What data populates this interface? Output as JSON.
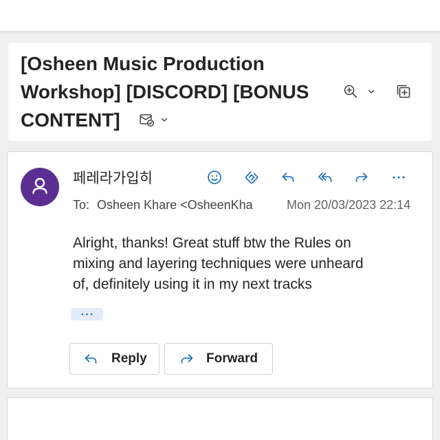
{
  "colors": {
    "accent": "#0f6cbd",
    "avatar_background": "#5c2e91",
    "text": "#242424",
    "secondary_text": "#616161"
  },
  "subject": {
    "text": "[Osheen Music Production Workshop] [DISCORD] [BONUS CONTENT]",
    "label_icon": "mail-shield-icon",
    "tools": [
      "zoom-in-icon",
      "square-plus-icon"
    ]
  },
  "message": {
    "avatar_icon": "person-icon",
    "sender": "페레라가입히",
    "actions": [
      "smiley-icon",
      "loop-icon",
      "reply-icon",
      "reply-all-icon",
      "forward-icon",
      "more-icon"
    ],
    "to_label": "To:",
    "recipient": "Osheen Khare <OsheenKha",
    "date": "Mon 20/03/2023 22:14",
    "body": "Alright, thanks! Great stuff btw the Rules on mixing and layering techniques were unheard of, definitely using it in my next tracks",
    "show_more_icon": "ellipsis-icon",
    "reply_button": {
      "icon": "reply-icon",
      "label": "Reply"
    },
    "forward_button": {
      "icon": "forward-icon",
      "label": "Forward"
    }
  }
}
